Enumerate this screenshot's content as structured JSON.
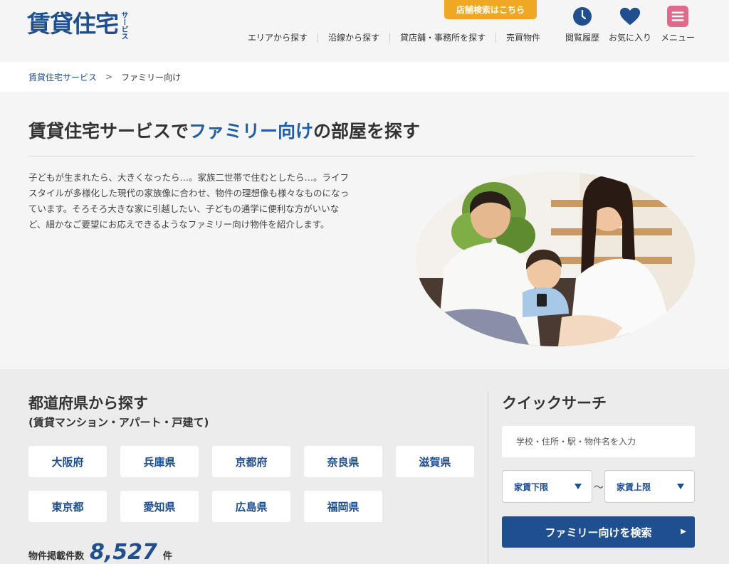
{
  "header": {
    "logo_main": "賃貸住宅",
    "logo_sub": "サービス",
    "store_search": "店舗検索はこちら",
    "nav": [
      "エリアから探す",
      "沿線から探す",
      "貸店舗・事務所を探す",
      "売買物件"
    ],
    "icons": {
      "history": {
        "label": "閲覧履歴",
        "icon": "clock-icon",
        "color": "#1f4f8f"
      },
      "favorites": {
        "label": "お気に入り",
        "icon": "heart-icon",
        "color": "#1f4f8f"
      },
      "menu": {
        "label": "メニュー",
        "icon": "hamburger-icon",
        "color": "#e06a8e"
      }
    }
  },
  "breadcrumb": {
    "home": "賃貸住宅サービス",
    "current": "ファミリー向け"
  },
  "intro": {
    "title_pre": "賃貸住宅サービスで",
    "title_highlight": "ファミリー向け",
    "title_post": "の部屋を探す",
    "text": "子どもが生まれたら、大きくなったら…。家族二世帯で住むとしたら…。ライフスタイルが多様化した現代の家族像に合わせ、物件の理想像も様々なものになっています。そろそろ大きな家に引越したい、子どもの通学に便利な方がいいなど、細かなご要望にお応えできるようなファミリー向け物件を紹介します。"
  },
  "prefecture": {
    "title": "都道府県から探す",
    "subtitle": "(賃貸マンション・アパート・戸建て)",
    "items": [
      "大阪府",
      "兵庫県",
      "京都府",
      "奈良県",
      "滋賀県",
      "東京都",
      "愛知県",
      "広島県",
      "福岡県"
    ],
    "count_label": "物件掲載件数",
    "count": "8,527",
    "count_unit": "件"
  },
  "quick_search": {
    "title": "クイックサーチ",
    "placeholder": "学校・住所・駅・物件名を入力",
    "rent_min": "家賃下限",
    "tilde": "～",
    "rent_max": "家賃上限",
    "button": "ファミリー向けを検索"
  },
  "colors": {
    "brand": "#1f4f8f",
    "accent": "#f0a824",
    "menu": "#e06a8e"
  }
}
